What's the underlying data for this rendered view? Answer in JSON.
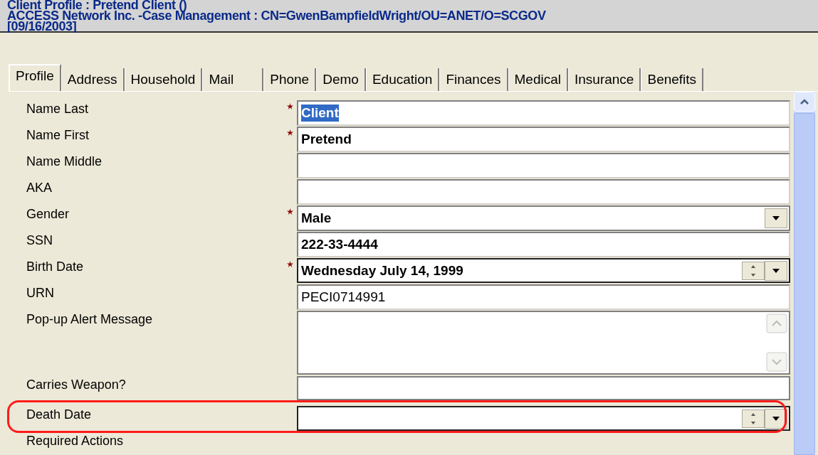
{
  "header": {
    "lines": [
      "Client Profile : Pretend Client ()",
      "ACCESS Network Inc. -Case Management :  CN=GwenBampfieldWright/OU=ANET/O=SCGOV",
      "[09/16/2003]"
    ]
  },
  "tabs": [
    {
      "label": "Profile",
      "selected": true
    },
    {
      "label": "Address",
      "selected": false
    },
    {
      "label": "Household",
      "selected": false
    },
    {
      "label": "Mail",
      "selected": false
    },
    {
      "label": "Phone",
      "selected": false
    },
    {
      "label": "Demo",
      "selected": false
    },
    {
      "label": "Education",
      "selected": false
    },
    {
      "label": "Finances",
      "selected": false
    },
    {
      "label": "Medical",
      "selected": false
    },
    {
      "label": "Insurance",
      "selected": false
    },
    {
      "label": "Benefits",
      "selected": false
    }
  ],
  "fields": [
    {
      "label": "Name Last",
      "kind": "text",
      "required": true,
      "value": "Client",
      "bold": true,
      "selected": true
    },
    {
      "label": "Name First",
      "kind": "text",
      "required": true,
      "value": "Pretend",
      "bold": true
    },
    {
      "label": "Name Middle",
      "kind": "text",
      "required": false
    },
    {
      "label": "AKA",
      "kind": "text",
      "required": false
    },
    {
      "label": "Gender",
      "kind": "dropdown",
      "required": true,
      "value": "Male",
      "bold": true
    },
    {
      "label": "SSN",
      "kind": "text",
      "required": false,
      "value": "222-33-4444",
      "bold": true
    },
    {
      "label": "Birth Date",
      "kind": "date",
      "required": true,
      "value": "Wednesday July 14, 1999",
      "bold": true
    },
    {
      "label": "URN",
      "kind": "text",
      "required": false,
      "value": "PECI0714991",
      "bold": false
    },
    {
      "label": "Pop-up Alert Message",
      "kind": "textarea",
      "required": false
    },
    {
      "label": "Carries Weapon?",
      "kind": "partial",
      "required": false
    },
    {
      "label": "Death Date",
      "kind": "date",
      "required": false,
      "highlighted": true
    },
    {
      "label": "Required Actions",
      "kind": "cut",
      "required": false
    }
  ]
}
